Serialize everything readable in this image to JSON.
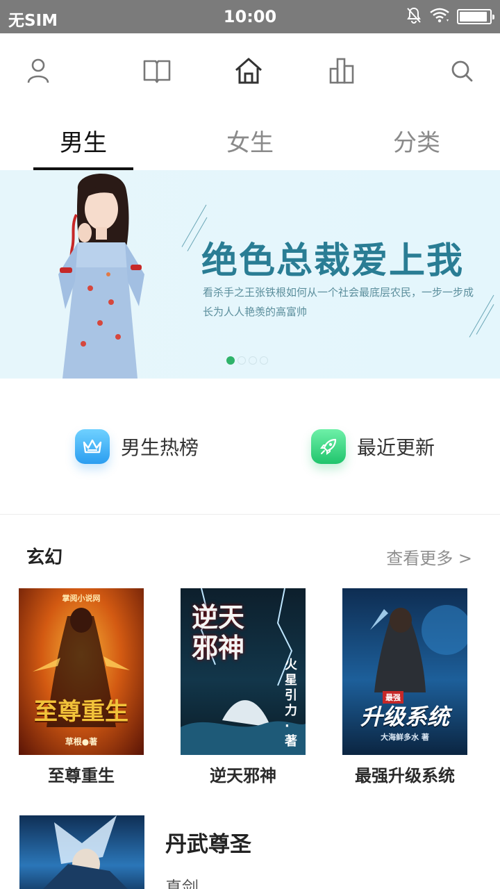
{
  "status_bar": {
    "carrier": "无SIM",
    "time": "10:00",
    "battery_level": 0.92
  },
  "top_nav": {
    "items": [
      {
        "icon": "user-icon"
      },
      {
        "icon": "book-open-icon"
      },
      {
        "icon": "home-icon"
      },
      {
        "icon": "bar-chart-icon"
      },
      {
        "icon": "search-icon"
      }
    ]
  },
  "tabs": [
    {
      "label": "男生",
      "active": true
    },
    {
      "label": "女生",
      "active": false
    },
    {
      "label": "分类",
      "active": false
    }
  ],
  "banner": {
    "title": "绝色总裁爱上我",
    "description": "看杀手之王张铁根如何从一个社会最底层农民，一步一步成长为人人艳羡的高富帅",
    "slide_count": 4,
    "active_slide": 0
  },
  "quick_links": [
    {
      "label": "男生热榜",
      "icon": "crown-icon",
      "color": "#2b9df0"
    },
    {
      "label": "最近更新",
      "icon": "rocket-icon",
      "color": "#20c46c"
    }
  ],
  "section": {
    "title": "玄幻",
    "more_label": "查看更多 >",
    "books": [
      {
        "title": "至尊重生",
        "cover_title": "至尊重生",
        "cover_top": "掌阅小说网",
        "cover_author": "草根●著"
      },
      {
        "title": "逆天邪神",
        "cover_title": "逆天邪神",
        "cover_author": "火星引力·著"
      },
      {
        "title": "最强升级系统",
        "cover_title": "升级系统",
        "cover_badge": "最强",
        "cover_author": "大海鲜多水 著"
      }
    ]
  },
  "list_book": {
    "title": "丹武尊圣",
    "author": "真剑"
  }
}
